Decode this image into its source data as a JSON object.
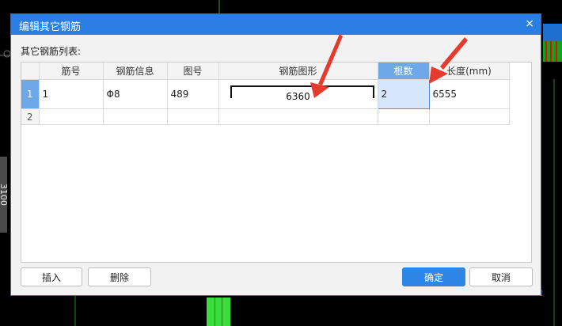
{
  "background": {
    "side_label": "3100"
  },
  "dialog": {
    "title": "编辑其它钢筋",
    "close_glyph": "×",
    "list_label": "其它钢筋列表:",
    "columns": [
      "筋号",
      "钢筋信息",
      "图号",
      "钢筋图形",
      "根数",
      "长度(mm)"
    ],
    "rows": [
      {
        "index": "1",
        "bar_no": "1",
        "bar_info": "Φ8",
        "fig_no": "489",
        "shape_dim": "6360",
        "count": "2",
        "length": "6555"
      },
      {
        "index": "2",
        "bar_no": "",
        "bar_info": "",
        "fig_no": "",
        "shape_dim": "",
        "count": "",
        "length": ""
      }
    ],
    "buttons": {
      "insert": "插入",
      "delete": "删除",
      "ok": "确定",
      "cancel": "取消"
    },
    "colors": {
      "title_bar": "#2b7fe3",
      "accent": "#2e86e6",
      "annotation_arrow": "#e53b2f"
    }
  }
}
